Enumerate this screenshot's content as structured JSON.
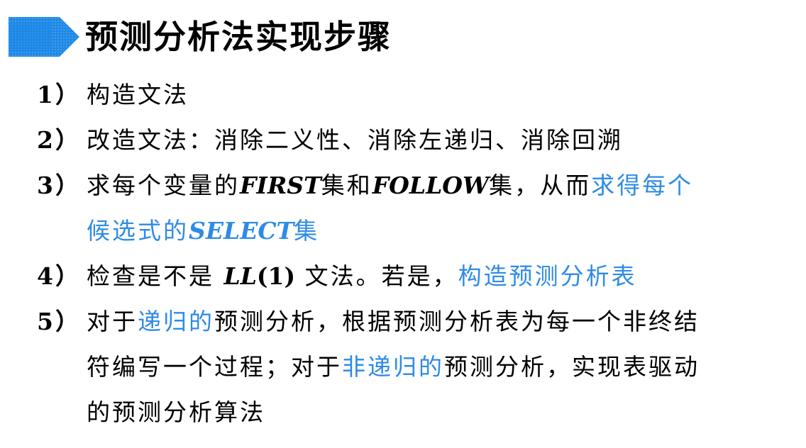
{
  "slide": {
    "title": "预测分析法实现步骤",
    "accent_color": "#2e8be6",
    "arrow_color": "#1e88e5"
  },
  "steps": [
    {
      "num": "1）",
      "text": "构造文法"
    },
    {
      "num": "2）",
      "text": "改造文法：消除二义性、消除左递归、消除回溯"
    },
    {
      "num": "3）",
      "a": "求每个变量的",
      "first": "FIRST",
      "b": "集和",
      "follow": "FOLLOW",
      "c": "集，从而",
      "hl1": "求得每个",
      "hl2": "候选式的",
      "select": "SELECT",
      "hl3": "集"
    },
    {
      "num": "4）",
      "a": "检查是不是 ",
      "ll": "LL",
      "paren": "(1)",
      "b": " 文法。若是，",
      "hl": "构造预测分析表"
    },
    {
      "num": "5）",
      "a": "对于",
      "hl1": "递归的",
      "b": "预测分析，根据预测分析表为每一个非终结",
      "c": "符编写一个过程；对于",
      "hl2": "非递归的",
      "d": "预测分析，实现表驱动",
      "e": "的预测分析算法"
    }
  ]
}
